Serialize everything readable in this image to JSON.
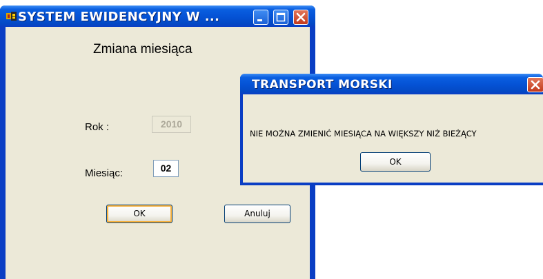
{
  "main_window": {
    "title": "SYSTEM  EWIDENCYJNY  W ...",
    "heading": "Zmiana  miesiąca",
    "year_label": "Rok :",
    "year_value": "2010",
    "month_label": "Miesiąc:",
    "month_value": "02",
    "ok_label": "OK",
    "cancel_label": "Anuluj"
  },
  "dialog": {
    "title": "TRANSPORT  MORSKI",
    "message": "NIE  MOŻNA ZMIENIĆ MIESIĄCA  NA  WIĘKSZY  NIŻ  BIEŻĄCY",
    "ok_label": "OK"
  },
  "icons": {
    "app": "app-icon",
    "minimize": "minimize-icon",
    "maximize": "maximize-icon",
    "close": "close-icon"
  },
  "colors": {
    "titlebar": "#0553d6",
    "client_bg": "#ece9d8",
    "close_button": "#c2391c",
    "focus_ring": "#f8b23e"
  }
}
